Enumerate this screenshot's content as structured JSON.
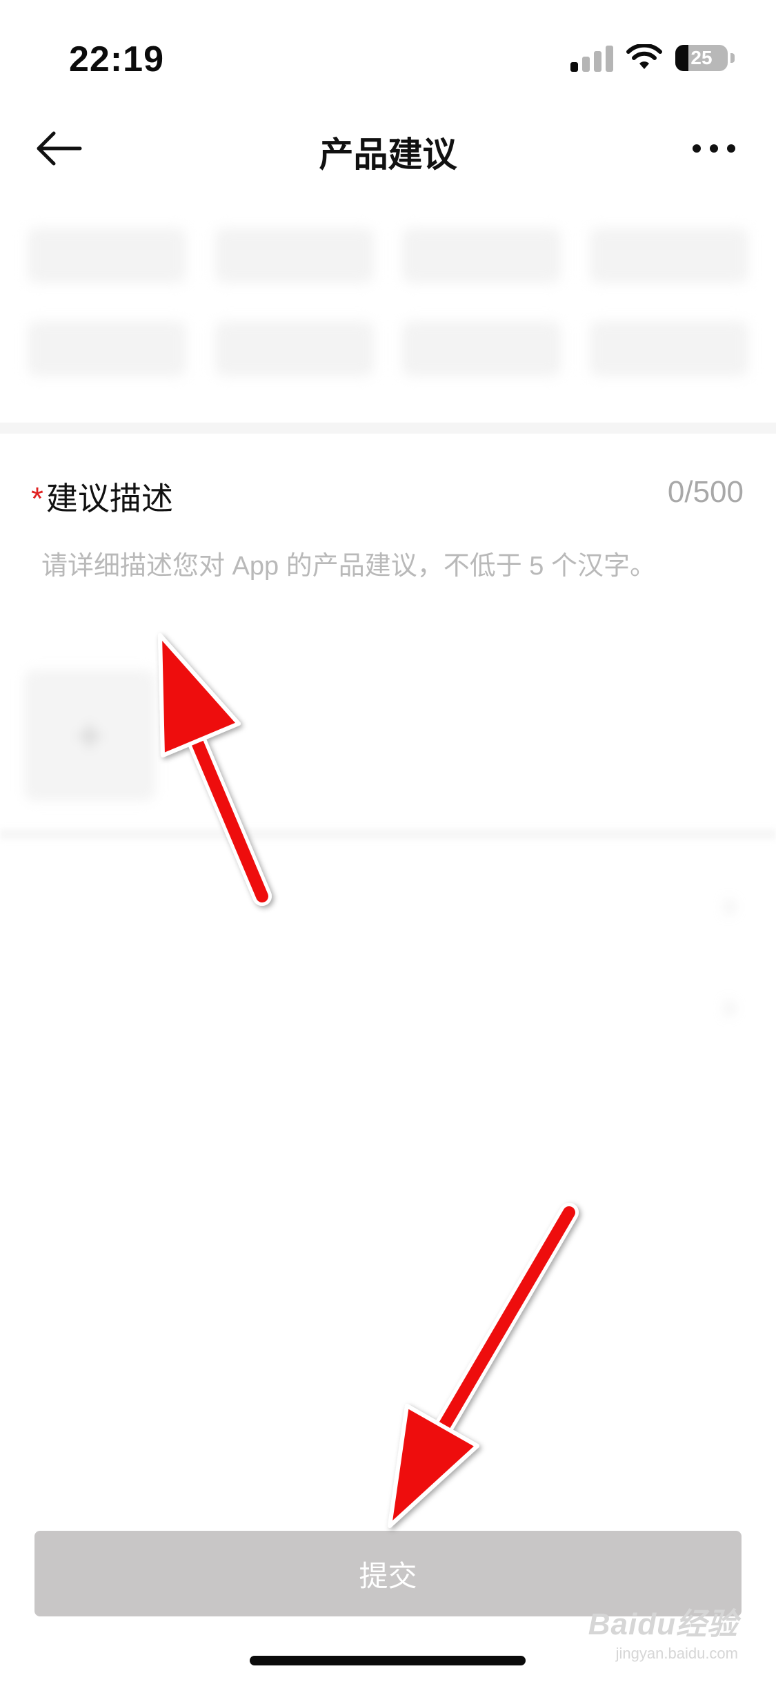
{
  "status_bar": {
    "time": "22:19",
    "battery_level": "25",
    "battery_fraction": 0.25,
    "signal_icon": "cellular-signal-icon",
    "wifi_icon": "wifi-icon"
  },
  "nav": {
    "title": "产品建议",
    "back_icon": "arrow-left-icon",
    "more_icon": "more-dots-icon"
  },
  "description": {
    "label": "建议描述",
    "required_mark": "*",
    "counter": "0/500",
    "value": "",
    "placeholder": "请详细描述您对 App 的产品建议，不低于 5 个汉字。"
  },
  "submit": {
    "label": "提交"
  },
  "colors": {
    "required_red": "#e02020",
    "submit_disabled": "#c8c6c6",
    "annotation_arrow": "#ee1111"
  },
  "watermark": {
    "brand": "Baidu经验",
    "url": "jingyan.baidu.com"
  }
}
